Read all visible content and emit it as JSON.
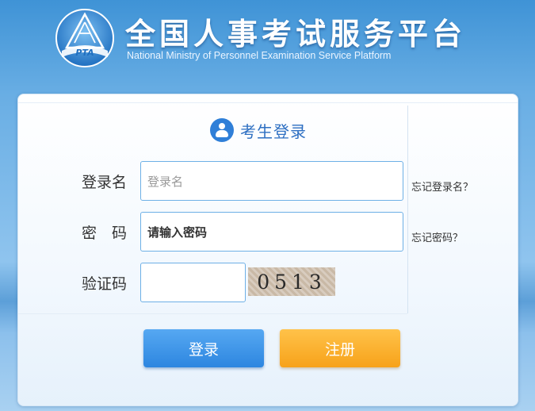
{
  "header": {
    "logo_text": "PTA",
    "title_cn": "全国人事考试服务平台",
    "title_en": "National Ministry of Personnel Examination Service Platform"
  },
  "login": {
    "title": "考生登录",
    "username_label": "登录名",
    "username_placeholder": "登录名",
    "password_label": "密　码",
    "password_placeholder": "请输入密码",
    "captcha_label": "验证码",
    "captcha_value": "",
    "captcha_image_text": "0513",
    "forgot_username": "忘记登录名？",
    "forgot_password": "忘记密码？",
    "login_button": "登录",
    "register_button": "注册"
  },
  "colors": {
    "brand_blue": "#2f7fd8",
    "login_button": "#2d86e0",
    "register_button": "#f7a21a"
  },
  "icons": {
    "logo": "pta-emblem-icon",
    "user": "user-icon"
  }
}
